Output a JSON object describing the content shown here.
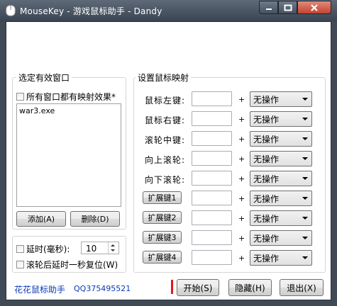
{
  "window": {
    "title": "MouseKey - 游戏鼠标助手 - Dandy",
    "minimize_icon": "minimize-icon",
    "maximize_icon": "maximize-icon",
    "close_icon": "close-icon"
  },
  "window_group": {
    "title": "选定有效窗口",
    "all_windows_checkbox": "所有窗口都有映射效果*",
    "window_list": [
      "war3.exe"
    ],
    "add_button": "添加(A)",
    "delete_button": "删除(D)"
  },
  "delay_group": {
    "delay_checkbox": "延时(毫秒):",
    "delay_value": "10",
    "reset_checkbox": "滚轮后延时一秒复位(W)"
  },
  "mapping_group": {
    "title": "设置鼠标映射",
    "rows": [
      {
        "label": "鼠标左键:",
        "action": "无操作"
      },
      {
        "label": "鼠标右键:",
        "action": "无操作"
      },
      {
        "label": "滚轮中键:",
        "action": "无操作"
      },
      {
        "label": "向上滚轮:",
        "action": "无操作"
      },
      {
        "label": "向下滚轮:",
        "action": "无操作"
      },
      {
        "label": "扩展键1",
        "action": "无操作"
      },
      {
        "label": "扩展键2",
        "action": "无操作"
      },
      {
        "label": "扩展键3",
        "action": "无操作"
      },
      {
        "label": "扩展键4",
        "action": "无操作"
      }
    ],
    "plus": "+"
  },
  "footer": {
    "app_link": "花花鼠标助手",
    "qq_link": "QQ375495521",
    "start_button": "开始(S)",
    "hide_button": "隐藏(H)",
    "exit_button": "退出(X)"
  },
  "colors": {
    "titlebar": "#3f4a56",
    "close_button": "#c3432f",
    "link": "#0a39b8",
    "red_marker": "#e11b1b"
  }
}
